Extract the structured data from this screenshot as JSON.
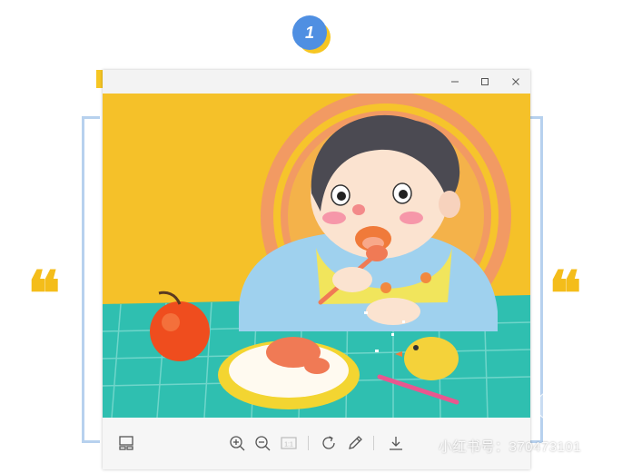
{
  "badge": {
    "number": "1"
  },
  "quotes": {
    "open": "❝",
    "close": "❝"
  },
  "window": {
    "title_buttons": [
      "minimize",
      "maximize",
      "close"
    ],
    "illustration_icon": "child-eating-illustration",
    "toolbar": {
      "left": [
        {
          "name": "gallery-layout-icon"
        }
      ],
      "center": [
        {
          "name": "zoom-in-icon"
        },
        {
          "name": "zoom-out-icon"
        },
        {
          "name": "actual-size-icon",
          "label": "1:1"
        },
        {
          "name": "rotate-icon"
        },
        {
          "name": "edit-pen-icon"
        },
        {
          "name": "download-icon"
        }
      ]
    }
  },
  "watermark": {
    "logo_text": "小红书",
    "id_text": "小红书号：370473101"
  },
  "colors": {
    "badge_blue": "#4f8fe2",
    "accent_yellow": "#f6c623",
    "frame_blue": "#b7d1ee",
    "illustration_yellow": "#f6c42c",
    "tablecloth_teal": "#2fbfb0"
  }
}
